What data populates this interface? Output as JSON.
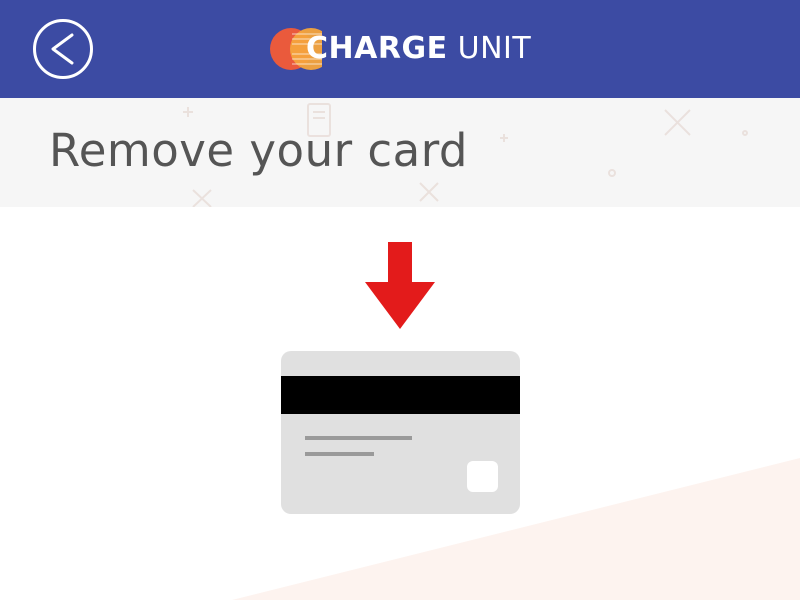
{
  "header": {
    "back_button_glyph": "<",
    "logo": {
      "bold_text": "CHARGE",
      "light_text": "UNIT",
      "circle_colors": [
        "#ea5a3c",
        "#f5a43c"
      ]
    },
    "background_color": "#3c4ba3"
  },
  "title_band": {
    "title": "Remove your card",
    "background_color": "#f6f6f6"
  },
  "instruction": {
    "arrow_icon": "arrow-down-icon",
    "arrow_color": "#e31b1b",
    "card_icon": "credit-card-back-icon"
  },
  "colors": {
    "accent_wedge": "#fdf3ef",
    "card_body": "#e0e0e0",
    "card_stripe": "#000000"
  }
}
